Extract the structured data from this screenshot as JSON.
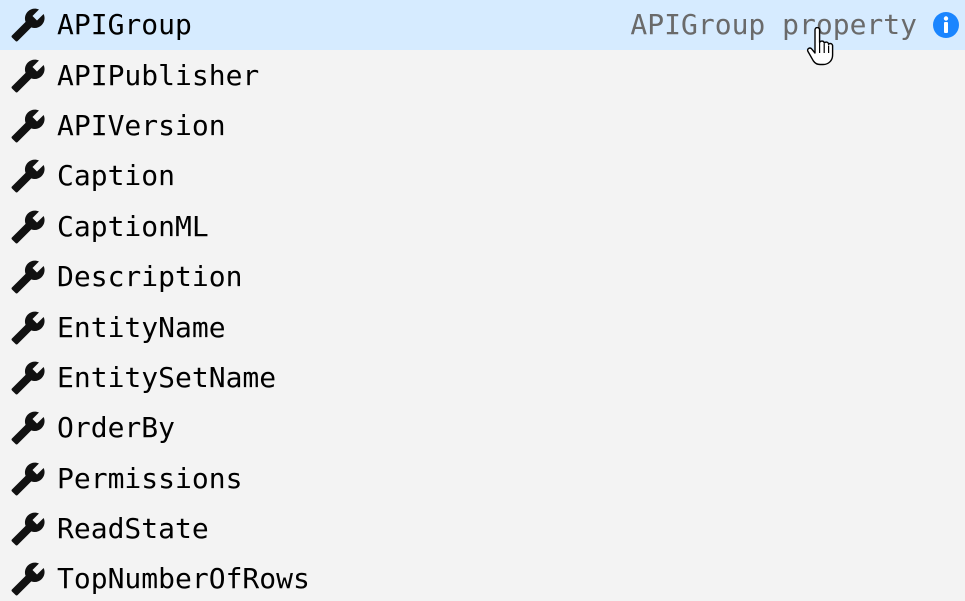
{
  "suggestions": {
    "items": [
      {
        "label": "APIGroup",
        "icon": "wrench-icon",
        "focused": true
      },
      {
        "label": "APIPublisher",
        "icon": "wrench-icon"
      },
      {
        "label": "APIVersion",
        "icon": "wrench-icon"
      },
      {
        "label": "Caption",
        "icon": "wrench-icon"
      },
      {
        "label": "CaptionML",
        "icon": "wrench-icon"
      },
      {
        "label": "Description",
        "icon": "wrench-icon"
      },
      {
        "label": "EntityName",
        "icon": "wrench-icon"
      },
      {
        "label": "EntitySetName",
        "icon": "wrench-icon"
      },
      {
        "label": "OrderBy",
        "icon": "wrench-icon"
      },
      {
        "label": "Permissions",
        "icon": "wrench-icon"
      },
      {
        "label": "ReadState",
        "icon": "wrench-icon"
      },
      {
        "label": "TopNumberOfRows",
        "icon": "wrench-icon"
      }
    ],
    "focused_detail": "APIGroup property",
    "detail_icon": "info-icon"
  },
  "colors": {
    "background": "#f3f3f3",
    "focused_row": "#d6ebff",
    "label_text": "#000000",
    "detail_text": "#6a6a6a",
    "wrench": "#111111",
    "info_badge": "#1a85ff"
  },
  "cursor": {
    "icon": "hand-pointer-cursor-icon"
  }
}
